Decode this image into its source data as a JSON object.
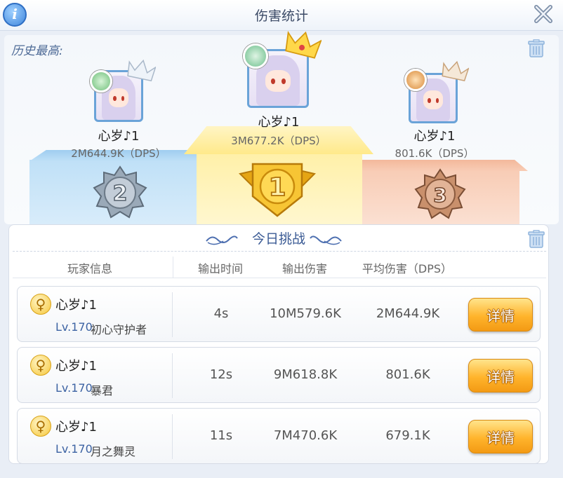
{
  "window": {
    "title": "伤害统计"
  },
  "best": {
    "label": "历史最高:",
    "ranks": [
      {
        "rank": "2",
        "name": "心岁♪1",
        "dps": "2M644.9K（DPS）"
      },
      {
        "rank": "1",
        "name": "心岁♪1",
        "dps": "3M677.2K（DPS）"
      },
      {
        "rank": "3",
        "name": "心岁♪1",
        "dps": "801.6K（DPS）"
      }
    ]
  },
  "today": {
    "title": "今日挑战",
    "headers": [
      "玩家信息",
      "输出时间",
      "输出伤害",
      "平均伤害（DPS）"
    ],
    "rows": [
      {
        "gender": "♀",
        "name": "心岁♪1",
        "level": "Lv.170",
        "class": "初心守护者",
        "time": "4s",
        "damage": "10M579.6K",
        "dps": "2M644.9K",
        "button": "详情"
      },
      {
        "gender": "♀",
        "name": "心岁♪1",
        "level": "Lv.170",
        "class": "暴君",
        "time": "12s",
        "damage": "9M618.8K",
        "dps": "801.6K",
        "button": "详情"
      },
      {
        "gender": "♀",
        "name": "心岁♪1",
        "level": "Lv.170",
        "class": "月之舞灵",
        "time": "11s",
        "damage": "7M470.6K",
        "dps": "679.1K",
        "button": "详情"
      }
    ]
  },
  "colors": {
    "gold": "#f5c63b",
    "silver": "#8fa0b3",
    "bronze": "#c98a6a",
    "accent": "#3a5a94"
  }
}
